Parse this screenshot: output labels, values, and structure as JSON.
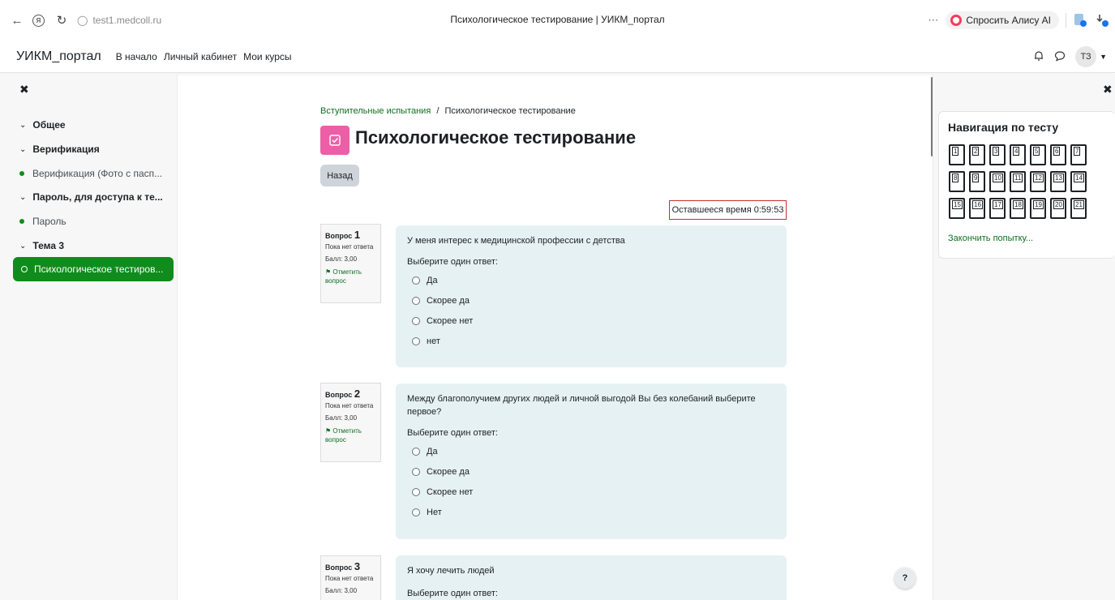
{
  "browser": {
    "url": "test1.medcoll.ru",
    "tab_title": "Психологическое тестирование | УИКМ_портал",
    "alice_label": "Спросить Алису AI"
  },
  "navbar": {
    "brand": "УИКМ_портал",
    "links": [
      "В начало",
      "Личный кабинет",
      "Мои курсы"
    ],
    "avatar_initials": "ТЗ"
  },
  "course_index": {
    "sections": [
      {
        "label": "Общее"
      },
      {
        "label": "Верификация"
      },
      {
        "label": "Пароль, для доступа к те..."
      },
      {
        "label": "Тема 3"
      }
    ],
    "activities": [
      {
        "label": "Верификация (Фото с пасп..."
      },
      {
        "label": "Пароль"
      },
      {
        "label": "Психологическое тестиров..."
      }
    ]
  },
  "breadcrumb": {
    "parent": "Вступительные испытания",
    "separator": "/",
    "current": "Психологическое тестирование"
  },
  "page": {
    "title": "Психологическое тестирование",
    "back_label": "Назад",
    "timer_label": "Оставшееся время",
    "timer_value": "0:59:53",
    "help_label": "?"
  },
  "questions": [
    {
      "label": "Вопрос",
      "number": "1",
      "state": "Пока нет ответа",
      "grade": "Балл: 3,00",
      "flag": "Отметить вопрос",
      "text": "У меня интерес к медицинской профессии с детства",
      "prompt": "Выберите один ответ:",
      "options": [
        "Да",
        "Скорее да",
        "Скорее нет",
        "нет"
      ]
    },
    {
      "label": "Вопрос",
      "number": "2",
      "state": "Пока нет ответа",
      "grade": "Балл: 3,00",
      "flag": "Отметить вопрос",
      "text": "Между благополучием других людей и личной выгодой Вы без колебаний выберите первое?",
      "prompt": "Выберите один ответ:",
      "options": [
        "Да",
        "Скорее да",
        "Скорее нет",
        "Нет"
      ]
    },
    {
      "label": "Вопрос",
      "number": "3",
      "state": "Пока нет ответа",
      "grade": "Балл: 3,00",
      "text": "Я хочу лечить людей",
      "prompt": "Выберите один ответ:"
    }
  ],
  "quiz_nav": {
    "title": "Навигация по тесту",
    "buttons": [
      "1",
      "2",
      "3",
      "4",
      "5",
      "6",
      "7",
      "8",
      "9",
      "10",
      "11",
      "12",
      "13",
      "14",
      "15",
      "16",
      "17",
      "18",
      "19",
      "20",
      "21"
    ],
    "finish_label": "Закончить попытку..."
  },
  "colors": {
    "accent_green": "#0f8c1c",
    "link_green": "#0f6e22",
    "question_bg": "#e6f1f3",
    "quiz_icon_pink": "#ec5fa6",
    "timer_border": "#c9302c"
  }
}
